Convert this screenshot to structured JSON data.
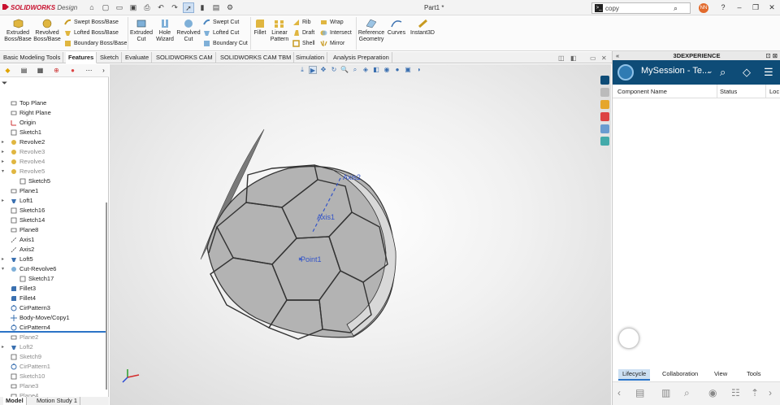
{
  "app": {
    "logo_brand": "SOLIDWORKS",
    "logo_sub": "Design",
    "doc_title": "Part1 *",
    "search_value": "copy",
    "avatar_initials": "NN"
  },
  "ribbon": {
    "extruded_boss": "Extruded Boss/Base",
    "revolved_boss": "Revolved Boss/Base",
    "swept_boss": "Swept Boss/Base",
    "lofted_boss": "Lofted Boss/Base",
    "boundary_boss": "Boundary Boss/Base",
    "extruded_cut": "Extruded Cut",
    "hole_wizard": "Hole Wizard",
    "revolved_cut": "Revolved Cut",
    "swept_cut": "Swept Cut",
    "lofted_cut": "Lofted Cut",
    "boundary_cut": "Boundary Cut",
    "fillet": "Fillet",
    "linear_pattern": "Linear Pattern",
    "rib": "Rib",
    "draft": "Draft",
    "shell": "Shell",
    "wrap": "Wrap",
    "intersect": "Intersect",
    "mirror": "Mirror",
    "reference_geometry": "Reference Geometry",
    "curves": "Curves",
    "instant3d": "Instant3D"
  },
  "command_tabs": [
    "Basic Modeling Tools",
    "Features",
    "Sketch",
    "Evaluate",
    "SOLIDWORKS CAM",
    "SOLIDWORKS CAM TBM",
    "Simulation",
    "Analysis Preparation"
  ],
  "tree": [
    {
      "label": "Top Plane",
      "icon": "plane",
      "exp": "",
      "indent": 0,
      "dim": false
    },
    {
      "label": "Right Plane",
      "icon": "plane",
      "exp": "",
      "indent": 0,
      "dim": false
    },
    {
      "label": "Origin",
      "icon": "origin",
      "exp": "",
      "indent": 0,
      "dim": false
    },
    {
      "label": "Sketch1",
      "icon": "sketch",
      "exp": "",
      "indent": 0,
      "dim": false
    },
    {
      "label": "Revolve2",
      "icon": "revolve",
      "exp": "▸",
      "indent": 0,
      "dim": false
    },
    {
      "label": "Revolve3",
      "icon": "revolve",
      "exp": "▸",
      "indent": 0,
      "dim": true
    },
    {
      "label": "Revolve4",
      "icon": "revolve",
      "exp": "▸",
      "indent": 0,
      "dim": true
    },
    {
      "label": "Revolve5",
      "icon": "revolve",
      "exp": "▾",
      "indent": 0,
      "dim": true
    },
    {
      "label": "Sketch5",
      "icon": "sketch",
      "exp": "",
      "indent": 1,
      "dim": false
    },
    {
      "label": "Plane1",
      "icon": "plane",
      "exp": "",
      "indent": 0,
      "dim": false
    },
    {
      "label": "Loft1",
      "icon": "loft",
      "exp": "▸",
      "indent": 0,
      "dim": false
    },
    {
      "label": "Sketch16",
      "icon": "sketch",
      "exp": "",
      "indent": 0,
      "dim": false
    },
    {
      "label": "Sketch14",
      "icon": "sketch",
      "exp": "",
      "indent": 0,
      "dim": false
    },
    {
      "label": "Plane8",
      "icon": "plane",
      "exp": "",
      "indent": 0,
      "dim": false
    },
    {
      "label": "Axis1",
      "icon": "axis",
      "exp": "",
      "indent": 0,
      "dim": false
    },
    {
      "label": "Axis2",
      "icon": "axis",
      "exp": "",
      "indent": 0,
      "dim": false
    },
    {
      "label": "Loft5",
      "icon": "loft",
      "exp": "▸",
      "indent": 0,
      "dim": false
    },
    {
      "label": "Cut-Revolve6",
      "icon": "cut",
      "exp": "▾",
      "indent": 0,
      "dim": false
    },
    {
      "label": "Sketch17",
      "icon": "sketch",
      "exp": "",
      "indent": 1,
      "dim": false
    },
    {
      "label": "Fillet3",
      "icon": "fillet",
      "exp": "",
      "indent": 0,
      "dim": false
    },
    {
      "label": "Fillet4",
      "icon": "fillet",
      "exp": "",
      "indent": 0,
      "dim": false
    },
    {
      "label": "CirPattern3",
      "icon": "pattern",
      "exp": "",
      "indent": 0,
      "dim": false
    },
    {
      "label": "Body-Move/Copy1",
      "icon": "move",
      "exp": "",
      "indent": 0,
      "dim": false
    },
    {
      "label": "CirPattern4",
      "icon": "pattern",
      "exp": "",
      "indent": 0,
      "dim": false,
      "selected": true
    },
    {
      "label": "Plane2",
      "icon": "plane",
      "exp": "",
      "indent": 0,
      "dim": true
    },
    {
      "label": "Loft2",
      "icon": "loft",
      "exp": "▸",
      "indent": 0,
      "dim": true
    },
    {
      "label": "Sketch9",
      "icon": "sketch",
      "exp": "",
      "indent": 0,
      "dim": true
    },
    {
      "label": "CirPattern1",
      "icon": "pattern",
      "exp": "",
      "indent": 0,
      "dim": true
    },
    {
      "label": "Sketch10",
      "icon": "sketch",
      "exp": "",
      "indent": 0,
      "dim": true
    },
    {
      "label": "Plane3",
      "icon": "plane",
      "exp": "",
      "indent": 0,
      "dim": true
    },
    {
      "label": "Plane4",
      "icon": "plane",
      "exp": "",
      "indent": 0,
      "dim": true
    }
  ],
  "bottom_tabs": [
    "Model",
    "Motion Study 1"
  ],
  "viewport": {
    "axis2_label": "Axis2",
    "axis1_label": "Axis1",
    "point1_label": "Point1"
  },
  "right_panel": {
    "header": "3DEXPERIENCE",
    "session_name": "MySession - Te...",
    "col_component": "Component Name",
    "col_status": "Status",
    "col_loc": "Loc",
    "tabs": [
      "Lifecycle",
      "Collaboration",
      "View",
      "Tools"
    ]
  },
  "colors": {
    "accent": "#2b73c6",
    "brand_red": "#c8102e",
    "session_bg": "#0e4c77",
    "ball_face": "#a9a9a9",
    "ball_seam": "#3d3d3d"
  }
}
